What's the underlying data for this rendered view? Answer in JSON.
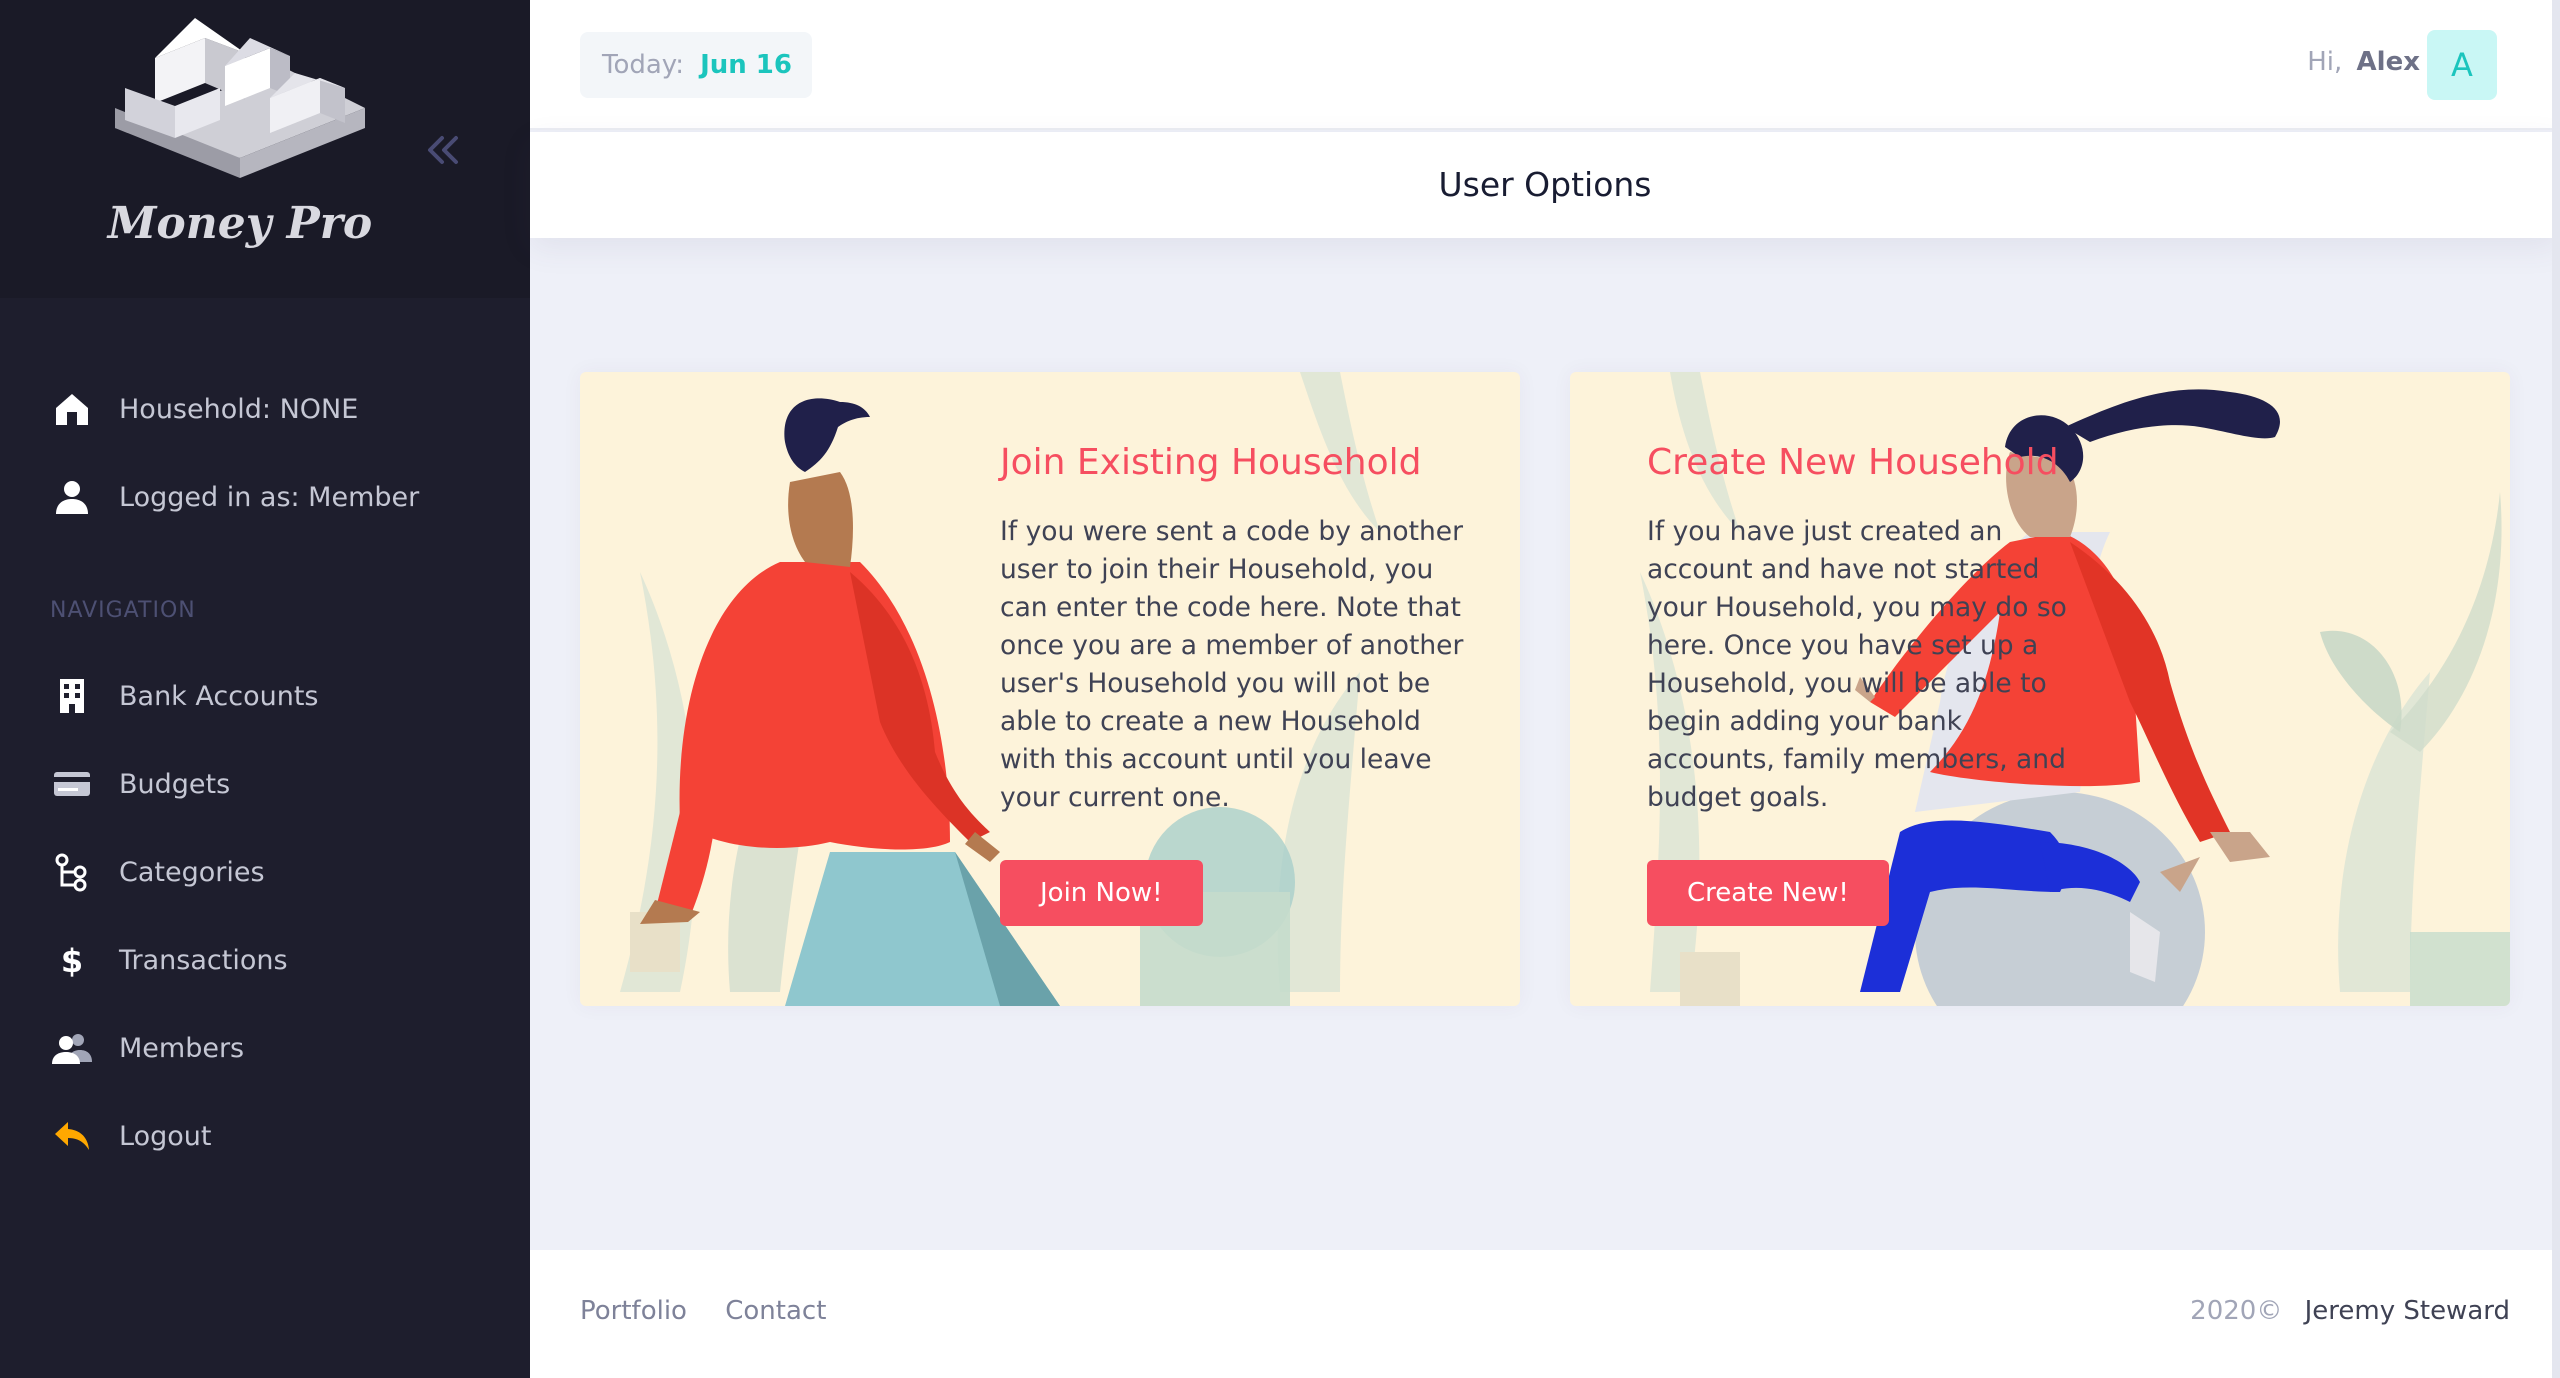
{
  "brand": {
    "name": "Money Pro"
  },
  "user_info": [
    {
      "label": "Household: NONE",
      "icon": "home-icon"
    },
    {
      "label": "Logged in as: Member",
      "icon": "user-icon"
    }
  ],
  "navigation": {
    "heading": "NAVIGATION",
    "items": [
      {
        "label": "Bank Accounts",
        "icon": "building-icon"
      },
      {
        "label": "Budgets",
        "icon": "credit-card-icon"
      },
      {
        "label": "Categories",
        "icon": "hierarchy-icon"
      },
      {
        "label": "Transactions",
        "icon": "dollar-icon"
      },
      {
        "label": "Members",
        "icon": "users-icon"
      },
      {
        "label": "Logout",
        "icon": "logout-arrow-icon"
      }
    ]
  },
  "header": {
    "today_label": "Today:",
    "today_value": "Jun 16",
    "greeting": "Hi,",
    "user_name": "Alex",
    "avatar_letter": "A"
  },
  "page": {
    "title": "User Options"
  },
  "cards": [
    {
      "title": "Join Existing Household",
      "text": "If you were sent a code by another user to join their Household, you can enter the code here. Note that once you are a member of another user's Household you will not be able to create a new Household with this account until you leave your current one.",
      "button": "Join Now!"
    },
    {
      "title": "Create New Household",
      "text": "If you have just created an account and have not started your Household, you may do so here. Once you have set up a Household, you will be able to begin adding your bank accounts, family members, and budget goals.",
      "button": "Create New!"
    }
  ],
  "footer": {
    "links": [
      "Portfolio",
      "Contact"
    ],
    "copyright": "2020©",
    "author": "Jeremy Steward"
  },
  "colors": {
    "sidebar": "#1e1e2d",
    "accent_red": "#f64e60",
    "accent_teal": "#1bc5bd",
    "card_bg": "#fdf3da",
    "logout_icon": "#ffa800"
  }
}
